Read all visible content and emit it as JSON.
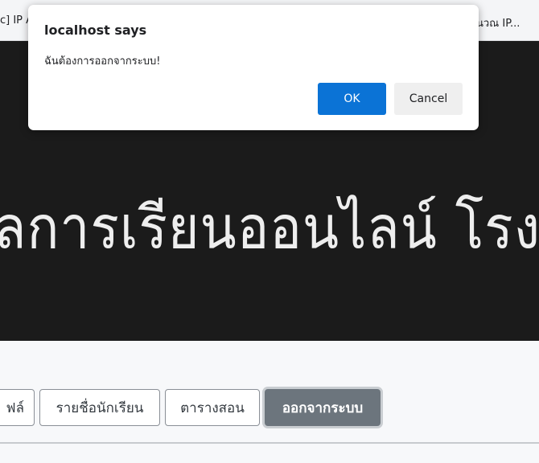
{
  "browser": {
    "bookmarks": {
      "left_label": "c] IP A",
      "right_label": "นวณ IP..."
    }
  },
  "hero": {
    "title": "ลการเรียนออนไลน์ โรงเรียนบ"
  },
  "nav": {
    "profile_label": "ฟล์",
    "students_label": "รายชื่อนักเรียน",
    "schedule_label": "ตารางสอน",
    "logout_label": "ออกจากระบบ"
  },
  "dialog": {
    "title": "localhost says",
    "message": "ฉันต้องการออกจากระบบ!",
    "ok_label": "OK",
    "cancel_label": "Cancel"
  },
  "colors": {
    "ok_button": "#0b73d6",
    "logout_button": "#6c757d",
    "hero_background": "#1b1b1b"
  }
}
